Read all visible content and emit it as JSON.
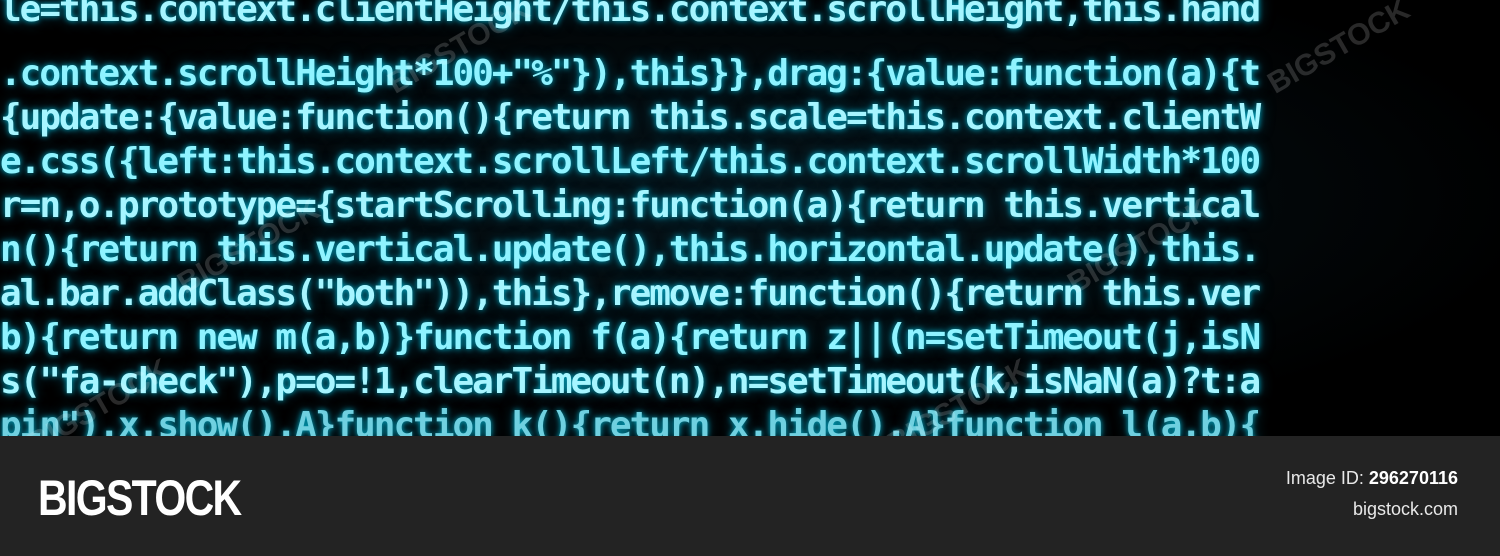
{
  "code_lines": [
    "le=this.context.clientHeight/this.context.scrollHeight,this.hand",
    ".context.scrollHeight*100+\"%\"}),this}},drag:{value:function(a){t",
    "{update:{value:function(){return this.scale=this.context.clientW",
    "e.css({left:this.context.scrollLeft/this.context.scrollWidth*100",
    "r=n,o.prototype={startScrolling:function(a){return this.vertical",
    "n(){return this.vertical.update(),this.horizontal.update(),this.",
    "al.bar.addClass(\"both\")),this},remove:function(){return this.ver",
    "b){return new m(a,b)}function f(a){return z||(n=setTimeout(j,isN",
    "s(\"fa-check\"),p=o=!1,clearTimeout(n),n=setTimeout(k,isNaN(a)?t:a",
    "pin\").x.show().A}function k(){return x.hide().A}function l(a.b){"
  ],
  "watermark": "BIGSTOCK",
  "footer": {
    "logo": "BIGSTOCK",
    "image_id_label": "Image ID:",
    "image_id": "296270116",
    "site": "bigstock.com"
  },
  "colors": {
    "code_text": "#8ff3ff",
    "code_glow": "#00c8e6",
    "footer_bg": "#232323"
  }
}
